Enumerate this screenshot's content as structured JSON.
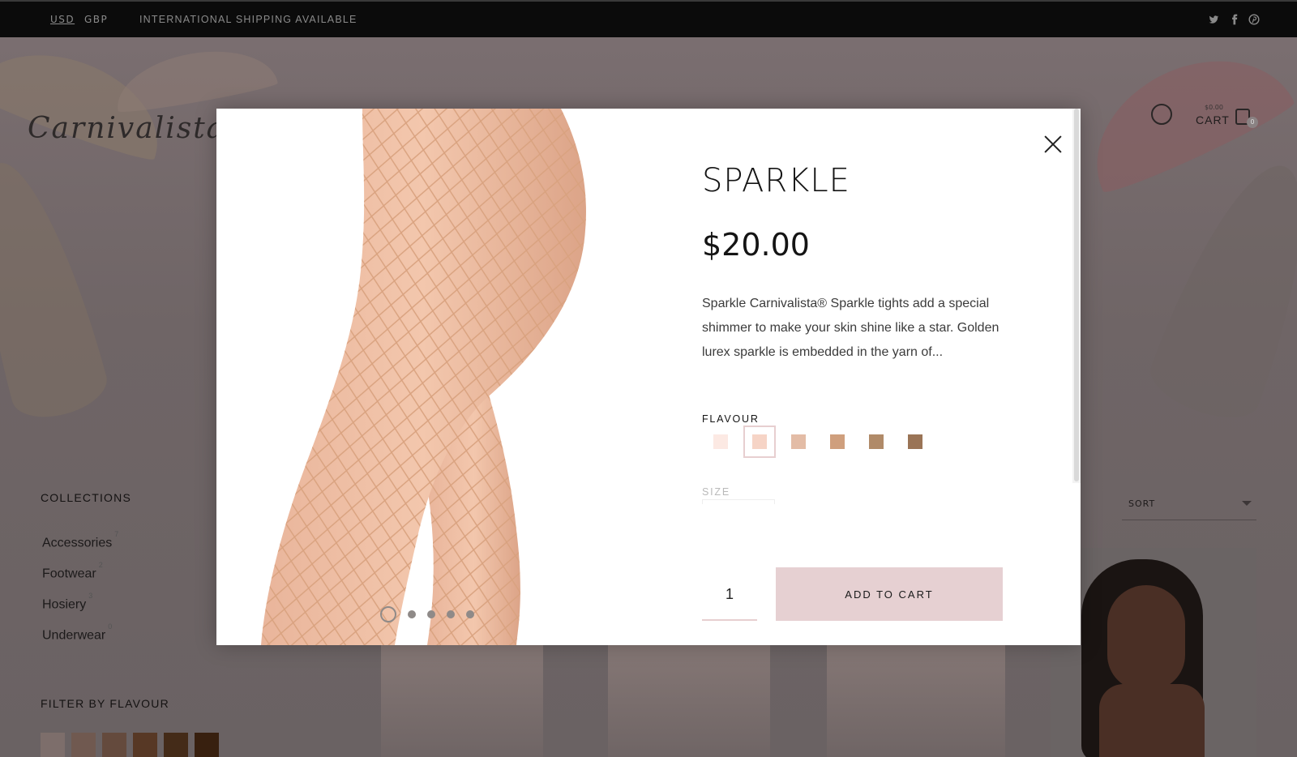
{
  "topbar": {
    "currency_usd": "USD",
    "currency_gbp": "GBP",
    "shipping": "INTERNATIONAL SHIPPING AVAILABLE",
    "social": [
      "twitter-icon",
      "facebook-icon",
      "pinterest-icon"
    ]
  },
  "header": {
    "logo": "Carnivalista",
    "cart_label": "CART",
    "cart_amount": "$0.00",
    "cart_count": "0"
  },
  "sidebar": {
    "collections_heading": "COLLECTIONS",
    "collections": [
      {
        "label": "Accessories",
        "count": "7"
      },
      {
        "label": "Footwear",
        "count": "2"
      },
      {
        "label": "Hosiery",
        "count": "3"
      },
      {
        "label": "Underwear",
        "count": "0"
      }
    ],
    "filter_heading": "FILTER BY FLAVOUR",
    "filter_swatches": [
      "#c9b2ad",
      "#b48f81",
      "#a27763",
      "#8c5a3c",
      "#6e4526",
      "#5a3418"
    ]
  },
  "toolbar": {
    "sort_label": "SORT"
  },
  "modal": {
    "title": "SPARKLE",
    "price": "$20.00",
    "description": "Sparkle  Carnivalista® Sparkle tights add a special shimmer to make your skin shine like a star. Golden lurex sparkle is embedded in the yarn of...",
    "flavour_label": "FLAVOUR",
    "flavours": [
      "#fce9e3",
      "#f6d4c6",
      "#e3bca6",
      "#cf9f7d",
      "#b08a68",
      "#9a7456"
    ],
    "selected_flavour_index": 1,
    "size_label": "SIZE",
    "quantity": "1",
    "add_to_cart": "ADD TO CART",
    "gallery_dots": 5,
    "active_dot": 0
  },
  "colors": {
    "accent": "#e6d0d2",
    "topbar_bg": "#0b0b0b",
    "overlay": "#6e6667"
  }
}
